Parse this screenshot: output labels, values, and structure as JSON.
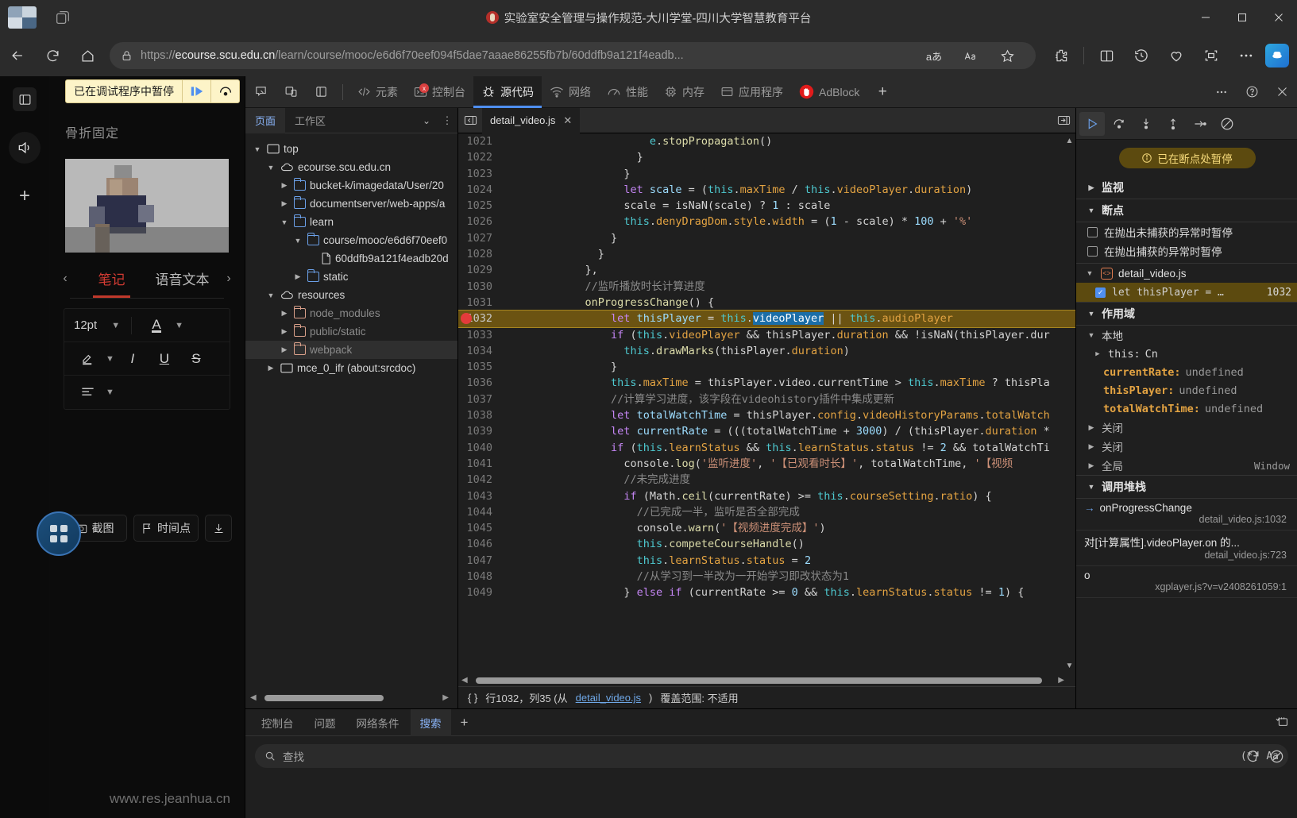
{
  "window": {
    "title": "实验室安全管理与操作规范-大川学堂-四川大学智慧教育平台",
    "minimize": "—",
    "maximize": "▢",
    "close": "✕"
  },
  "browser": {
    "back_icon": "back-arrow",
    "reload_icon": "reload",
    "home_icon": "home",
    "url_secure": "https://ecourse.scu.edu.cn",
    "url_host": "ecourse.scu.edu.cn",
    "url_prefix": "https://",
    "url_rest": "/learn/course/mooc/e6d6f70eef094f5dae7aaae86255fb7b/60ddfb9a121f4eadb...",
    "read_aloud": "aあ",
    "immersive": "A̲ᴀ",
    "favorite": "☆"
  },
  "page_overlay": {
    "pause_banner": "已在调试程序中暂停",
    "note_title": "骨折固定",
    "tabs": {
      "prev": "‹",
      "next": "›",
      "items": [
        "笔记",
        "语音文本"
      ],
      "active": 0
    },
    "font_size": "12pt",
    "text_color_icon": "A",
    "pen_icon": "highlighter",
    "italic": "I",
    "underline": "U",
    "strike": "S",
    "align_icon": "align-left",
    "buttons": [
      {
        "label": "截图",
        "icon": "camera-icon"
      },
      {
        "label": "时间点",
        "icon": "flag-icon"
      },
      {
        "label": "",
        "icon": "download-icon"
      }
    ],
    "watermark": "www.res.jeanhua.cn"
  },
  "devtools": {
    "left_icons": [
      "inspect-icon",
      "device-toolbar-icon",
      "dock-side-icon"
    ],
    "tabs": [
      {
        "label": "元素",
        "icon": "code-brackets-icon",
        "selected": false
      },
      {
        "label": "控制台",
        "icon": "console-icon",
        "selected": false,
        "error_badge": "x"
      },
      {
        "label": "源代码",
        "icon": "bug-icon",
        "selected": true
      },
      {
        "label": "网络",
        "icon": "wifi-icon",
        "selected": false
      },
      {
        "label": "性能",
        "icon": "performance-icon",
        "selected": false
      },
      {
        "label": "内存",
        "icon": "memory-chip-icon",
        "selected": false
      },
      {
        "label": "应用程序",
        "icon": "application-icon",
        "selected": false
      },
      {
        "label": "AdBlock",
        "icon": "adblock-hand-icon",
        "selected": false
      }
    ],
    "add_tab": "+",
    "right_icons": [
      "more-vertical-icon",
      "help-icon",
      "close-icon"
    ]
  },
  "navigator": {
    "tabs": [
      {
        "label": "页面",
        "selected": true
      },
      {
        "label": "工作区",
        "selected": false
      }
    ],
    "chevron": "⌄",
    "more": "⋮",
    "tree": [
      {
        "depth": 0,
        "label": "top",
        "icon": "frame-icon",
        "tri": "▼",
        "dim": false
      },
      {
        "depth": 1,
        "label": "ecourse.scu.edu.cn",
        "icon": "cloud-icon",
        "tri": "▼",
        "dim": false
      },
      {
        "depth": 2,
        "label": "bucket-k/imagedata/User/20",
        "icon": "folder-blue-icon",
        "tri": "▶",
        "dim": false
      },
      {
        "depth": 2,
        "label": "documentserver/web-apps/a",
        "icon": "folder-blue-icon",
        "tri": "▶",
        "dim": false
      },
      {
        "depth": 2,
        "label": "learn",
        "icon": "folder-blue-icon",
        "tri": "▼",
        "dim": false
      },
      {
        "depth": 3,
        "label": "course/mooc/e6d6f70eef0",
        "icon": "folder-blue-icon",
        "tri": "▼",
        "dim": false
      },
      {
        "depth": 4,
        "label": "60ddfb9a121f4eadb20d",
        "icon": "file-icon",
        "tri": "",
        "dim": false
      },
      {
        "depth": 3,
        "label": "static",
        "icon": "folder-blue-icon",
        "tri": "▶",
        "dim": false
      },
      {
        "depth": 1,
        "label": "resources",
        "icon": "cloud-icon",
        "tri": "▼",
        "dim": false
      },
      {
        "depth": 2,
        "label": "node_modules",
        "icon": "folder-orange-icon",
        "tri": "▶",
        "dim": true
      },
      {
        "depth": 2,
        "label": "public/static",
        "icon": "folder-orange-icon",
        "tri": "▶",
        "dim": true
      },
      {
        "depth": 2,
        "label": "webpack",
        "icon": "folder-orange-icon",
        "tri": "▶",
        "dim": true,
        "selected": true
      },
      {
        "depth": 1,
        "label": "mce_0_ifr (about:srcdoc)",
        "icon": "frame-icon",
        "tri": "▶",
        "dim": false
      }
    ]
  },
  "editor": {
    "back_icon": "show-navigator-icon",
    "file_tab": "detail_video.js",
    "close_tab": "✕",
    "expand_icon": "show-debugger-icon",
    "status": {
      "braces": "{ }",
      "line_col": "行1032，列35 (从",
      "link": "detail_video.js",
      "after": ")",
      "coverage": "覆盖范围: 不适用"
    },
    "lines": [
      {
        "n": 1021,
        "indent": 11,
        "tokens": [
          [
            "th",
            "e"
          ],
          [
            "op",
            "."
          ],
          [
            "fn",
            "stopPropagation"
          ],
          [
            "op",
            "()"
          ]
        ]
      },
      {
        "n": 1022,
        "indent": 10,
        "tokens": [
          [
            "op",
            "}"
          ]
        ]
      },
      {
        "n": 1023,
        "indent": 9,
        "tokens": [
          [
            "op",
            "}"
          ]
        ]
      },
      {
        "n": 1024,
        "indent": 9,
        "tokens": [
          [
            "kw",
            "let "
          ],
          [
            "num",
            "scale"
          ],
          [
            "op",
            " = ("
          ],
          [
            "th",
            "this"
          ],
          [
            "op",
            "."
          ],
          [
            "prop",
            "maxTime"
          ],
          [
            "op",
            " / "
          ],
          [
            "th",
            "this"
          ],
          [
            "op",
            "."
          ],
          [
            "prop",
            "videoPlayer"
          ],
          [
            "op",
            "."
          ],
          [
            "prop",
            "duration"
          ],
          [
            "op",
            ")"
          ]
        ]
      },
      {
        "n": 1025,
        "indent": 9,
        "tokens": [
          [
            "op",
            "scale = isNaN(scale) ? "
          ],
          [
            "num",
            "1"
          ],
          [
            "op",
            " : scale"
          ]
        ]
      },
      {
        "n": 1026,
        "indent": 9,
        "tokens": [
          [
            "th",
            "this"
          ],
          [
            "op",
            "."
          ],
          [
            "prop",
            "denyDragDom"
          ],
          [
            "op",
            "."
          ],
          [
            "prop",
            "style"
          ],
          [
            "op",
            "."
          ],
          [
            "prop",
            "width"
          ],
          [
            "op",
            " = ("
          ],
          [
            "num",
            "1"
          ],
          [
            "op",
            " - scale) * "
          ],
          [
            "num",
            "100"
          ],
          [
            "op",
            " + "
          ],
          [
            "str",
            "'%'"
          ]
        ]
      },
      {
        "n": 1027,
        "indent": 8,
        "tokens": [
          [
            "op",
            "}"
          ]
        ]
      },
      {
        "n": 1028,
        "indent": 7,
        "tokens": [
          [
            "op",
            "}"
          ]
        ]
      },
      {
        "n": 1029,
        "indent": 6,
        "tokens": [
          [
            "op",
            "},"
          ]
        ]
      },
      {
        "n": 1030,
        "indent": 6,
        "tokens": [
          [
            "cmt",
            "//监听播放时长计算进度"
          ]
        ]
      },
      {
        "n": 1031,
        "indent": 6,
        "tokens": [
          [
            "fn",
            "onProgressChange"
          ],
          [
            "op",
            "() {"
          ]
        ]
      },
      {
        "n": 1032,
        "indent": 8,
        "breakpoint": true,
        "highlight": true,
        "tokens": [
          [
            "kw",
            "let "
          ],
          [
            "num",
            "thisPlayer"
          ],
          [
            "op",
            " = "
          ],
          [
            "th",
            "this"
          ],
          [
            "op",
            "."
          ],
          [
            "seltok",
            "videoPlayer"
          ],
          [
            "op",
            " || "
          ],
          [
            "th",
            "this"
          ],
          [
            "op",
            "."
          ],
          [
            "prop",
            "audioPlayer"
          ]
        ]
      },
      {
        "n": 1033,
        "indent": 8,
        "tokens": [
          [
            "kw",
            "if"
          ],
          [
            "op",
            " ("
          ],
          [
            "th",
            "this"
          ],
          [
            "op",
            "."
          ],
          [
            "prop",
            "videoPlayer"
          ],
          [
            "op",
            " && thisPlayer."
          ],
          [
            "prop",
            "duration"
          ],
          [
            "op",
            " && !isNaN(thisPlayer.dur"
          ]
        ]
      },
      {
        "n": 1034,
        "indent": 9,
        "tokens": [
          [
            "th",
            "this"
          ],
          [
            "op",
            "."
          ],
          [
            "fn",
            "drawMarks"
          ],
          [
            "op",
            "(thisPlayer."
          ],
          [
            "prop",
            "duration"
          ],
          [
            "op",
            ")"
          ]
        ]
      },
      {
        "n": 1035,
        "indent": 8,
        "tokens": [
          [
            "op",
            "}"
          ]
        ]
      },
      {
        "n": 1036,
        "indent": 8,
        "tokens": [
          [
            "th",
            "this"
          ],
          [
            "op",
            "."
          ],
          [
            "prop",
            "maxTime"
          ],
          [
            "op",
            " = thisPlayer.video.currentTime > "
          ],
          [
            "th",
            "this"
          ],
          [
            "op",
            "."
          ],
          [
            "prop",
            "maxTime"
          ],
          [
            "op",
            " ? thisPla"
          ]
        ]
      },
      {
        "n": 1037,
        "indent": 8,
        "tokens": [
          [
            "cmt",
            "//计算学习进度，该字段在videohistory插件中集成更新"
          ]
        ]
      },
      {
        "n": 1038,
        "indent": 8,
        "tokens": [
          [
            "kw",
            "let "
          ],
          [
            "num",
            "totalWatchTime"
          ],
          [
            "op",
            " = thisPlayer."
          ],
          [
            "prop",
            "config"
          ],
          [
            "op",
            "."
          ],
          [
            "prop",
            "videoHistoryParams"
          ],
          [
            "op",
            "."
          ],
          [
            "prop",
            "totalWatch"
          ]
        ]
      },
      {
        "n": 1039,
        "indent": 8,
        "tokens": [
          [
            "kw",
            "let "
          ],
          [
            "num",
            "currentRate"
          ],
          [
            "op",
            " = (((totalWatchTime + "
          ],
          [
            "num",
            "3000"
          ],
          [
            "op",
            ") / (thisPlayer."
          ],
          [
            "prop",
            "duration"
          ],
          [
            "op",
            " *"
          ]
        ]
      },
      {
        "n": 1040,
        "indent": 8,
        "tokens": [
          [
            "kw",
            "if"
          ],
          [
            "op",
            " ("
          ],
          [
            "th",
            "this"
          ],
          [
            "op",
            "."
          ],
          [
            "prop",
            "learnStatus"
          ],
          [
            "op",
            " && "
          ],
          [
            "th",
            "this"
          ],
          [
            "op",
            "."
          ],
          [
            "prop",
            "learnStatus"
          ],
          [
            "op",
            "."
          ],
          [
            "prop",
            "status"
          ],
          [
            "op",
            " != "
          ],
          [
            "num",
            "2"
          ],
          [
            "op",
            " && totalWatchTi"
          ]
        ]
      },
      {
        "n": 1041,
        "indent": 9,
        "tokens": [
          [
            "op",
            "console."
          ],
          [
            "fn",
            "log"
          ],
          [
            "op",
            "("
          ],
          [
            "str",
            "'监听进度'"
          ],
          [
            "op",
            ", "
          ],
          [
            "str",
            "'【已观看时长】'"
          ],
          [
            "op",
            ", totalWatchTime, "
          ],
          [
            "str",
            "'【视频"
          ]
        ]
      },
      {
        "n": 1042,
        "indent": 9,
        "tokens": [
          [
            "cmt",
            "//未完成进度"
          ]
        ]
      },
      {
        "n": 1043,
        "indent": 9,
        "tokens": [
          [
            "kw",
            "if"
          ],
          [
            "op",
            " (Math."
          ],
          [
            "fn",
            "ceil"
          ],
          [
            "op",
            "(currentRate) >= "
          ],
          [
            "th",
            "this"
          ],
          [
            "op",
            "."
          ],
          [
            "prop",
            "courseSetting"
          ],
          [
            "op",
            "."
          ],
          [
            "prop",
            "ratio"
          ],
          [
            "op",
            ") {"
          ]
        ]
      },
      {
        "n": 1044,
        "indent": 10,
        "tokens": [
          [
            "cmt",
            "//已完成一半，监听是否全部完成"
          ]
        ]
      },
      {
        "n": 1045,
        "indent": 10,
        "tokens": [
          [
            "op",
            "console."
          ],
          [
            "fn",
            "warn"
          ],
          [
            "op",
            "("
          ],
          [
            "str",
            "'【视频进度完成】'"
          ],
          [
            "op",
            ")"
          ]
        ]
      },
      {
        "n": 1046,
        "indent": 10,
        "tokens": [
          [
            "th",
            "this"
          ],
          [
            "op",
            "."
          ],
          [
            "fn",
            "competeCourseHandle"
          ],
          [
            "op",
            "()"
          ]
        ]
      },
      {
        "n": 1047,
        "indent": 10,
        "tokens": [
          [
            "th",
            "this"
          ],
          [
            "op",
            "."
          ],
          [
            "prop",
            "learnStatus"
          ],
          [
            "op",
            "."
          ],
          [
            "prop",
            "status"
          ],
          [
            "op",
            " = "
          ],
          [
            "num",
            "2"
          ]
        ]
      },
      {
        "n": 1048,
        "indent": 10,
        "tokens": [
          [
            "cmt",
            "//从学习到一半改为一开始学习即改状态为1"
          ]
        ]
      },
      {
        "n": 1049,
        "indent": 9,
        "tokens": [
          [
            "op",
            "} "
          ],
          [
            "kw",
            "else if"
          ],
          [
            "op",
            " (currentRate >= "
          ],
          [
            "num",
            "0"
          ],
          [
            "op",
            " && "
          ],
          [
            "th",
            "this"
          ],
          [
            "op",
            "."
          ],
          [
            "prop",
            "learnStatus"
          ],
          [
            "op",
            "."
          ],
          [
            "prop",
            "status"
          ],
          [
            "op",
            " != "
          ],
          [
            "num",
            "1"
          ],
          [
            "op",
            ") {"
          ]
        ]
      }
    ]
  },
  "debugger": {
    "controls": [
      "resume-icon",
      "step-over-icon",
      "step-into-icon",
      "step-out-icon",
      "step-icon",
      "deactivate-breakpoints-icon"
    ],
    "paused_pill": {
      "icon": "info-icon",
      "text": "已在断点处暂停"
    },
    "watch": {
      "tri": "▶",
      "label": "监视"
    },
    "breakpoints": {
      "tri": "▼",
      "label": "断点"
    },
    "pause_options": [
      {
        "label": "在抛出未捕获的异常时暂停",
        "checked": false
      },
      {
        "label": "在抛出捕获的异常时暂停",
        "checked": false
      }
    ],
    "bp_file": {
      "tri": "▼",
      "name": "detail_video.js",
      "icon": "js-file-icon"
    },
    "bp_entry": {
      "checked": true,
      "text": "let thisPlayer = …",
      "line": "1032"
    },
    "scope": {
      "tri": "▼",
      "label": "作用域"
    },
    "scope_local": {
      "tri": "▼",
      "label": "本地"
    },
    "scope_vars": [
      {
        "tri": "▶",
        "name": "this:",
        "value": "Cn",
        "plain": true
      },
      {
        "name": "currentRate:",
        "value": "undefined"
      },
      {
        "name": "thisPlayer:",
        "value": "undefined"
      },
      {
        "name": "totalWatchTime:",
        "value": "undefined"
      }
    ],
    "scope_groups": [
      {
        "tri": "▶",
        "label": "关闭",
        "right": ""
      },
      {
        "tri": "▶",
        "label": "关闭",
        "right": ""
      },
      {
        "tri": "▶",
        "label": "全局",
        "right": "Window"
      }
    ],
    "callstack": {
      "tri": "▼",
      "label": "调用堆栈"
    },
    "frames": [
      {
        "selected": true,
        "name": "onProgressChange",
        "src": "detail_video.js:1032"
      },
      {
        "selected": false,
        "name": "对[计算属性].videoPlayer.on 的...",
        "src": "detail_video.js:723"
      },
      {
        "selected": false,
        "name": "o",
        "src": "xgplayer.js?v=v2408261059:1"
      }
    ]
  },
  "drawer": {
    "tabs": [
      {
        "label": "控制台",
        "selected": false
      },
      {
        "label": "问题",
        "selected": false
      },
      {
        "label": "网络条件",
        "selected": false
      },
      {
        "label": "搜索",
        "selected": true
      }
    ],
    "add": "+",
    "right_icon": "refresh-screencast-icon",
    "search": {
      "icon": "search-icon",
      "placeholder": "查找",
      "value": "",
      "regex": "(*)",
      "matchcase": "Aa",
      "refresh": "⟳",
      "clear": "⊘"
    }
  }
}
